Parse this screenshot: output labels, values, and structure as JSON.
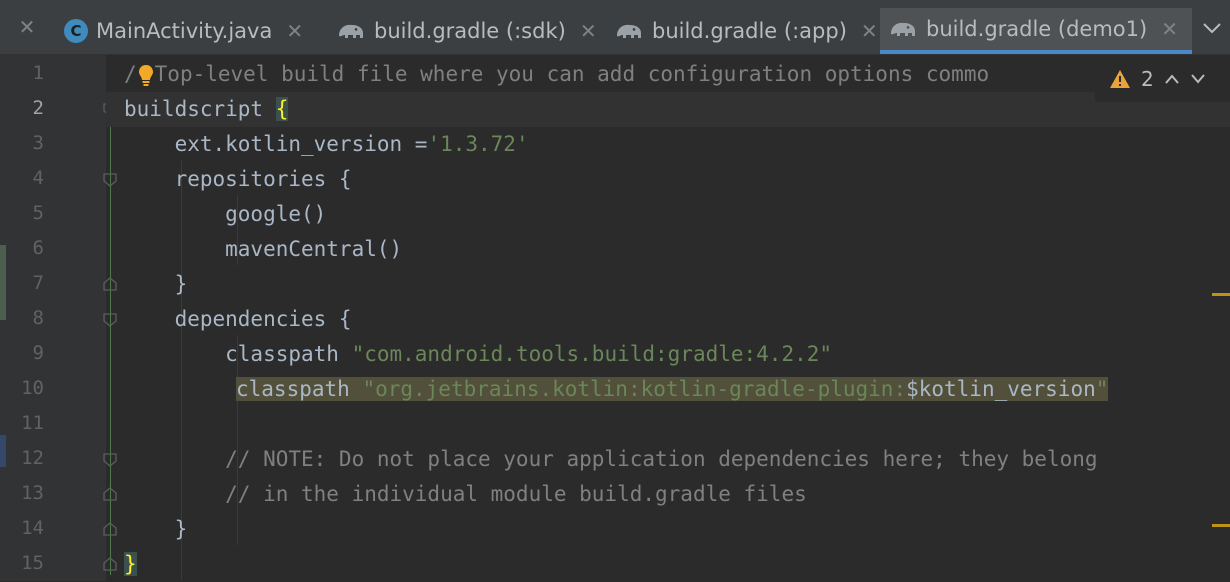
{
  "tabs": [
    {
      "label": "MainActivity.java",
      "icon": "java-class-icon",
      "active": false
    },
    {
      "label": "build.gradle (:sdk)",
      "icon": "gradle-icon",
      "active": false
    },
    {
      "label": "build.gradle (:app)",
      "icon": "gradle-icon",
      "active": false
    },
    {
      "label": "build.gradle (demo1)",
      "icon": "gradle-icon",
      "active": true
    }
  ],
  "inspections": {
    "warning_count": "2"
  },
  "line_numbers": [
    "1",
    "2",
    "3",
    "4",
    "5",
    "6",
    "7",
    "8",
    "9",
    "10",
    "11",
    "12",
    "13",
    "14",
    "15"
  ],
  "code": {
    "l1_slash": "/",
    "l1_comment": "Top-level build file where you can add configuration options commo",
    "l2_ident": "buildscript ",
    "l2_brace": "{",
    "l3_ident": "    ext.kotlin_version =",
    "l3_str": "'1.3.72'",
    "l4": "    repositories {",
    "l5": "        google()",
    "l6": "        mavenCentral()",
    "l7": "    }",
    "l8": "    dependencies {",
    "l9_ident": "        classpath ",
    "l9_str": "\"com.android.tools.build:gradle:4.2.2\"",
    "l10_ident": "classpath ",
    "l10_str": "\"org.jetbrains.kotlin:kotlin-gradle-plugin:",
    "l10_var": "$kotlin_version",
    "l10_end": "\"",
    "l12": "        // NOTE: Do not place your application dependencies here; they belong",
    "l13": "        // in the individual module build.gradle files",
    "l14": "    }",
    "l15": "}"
  },
  "colors": {
    "background": "#2b2b2b",
    "string": "#6a8759",
    "comment": "#808080",
    "identifier": "#a9b7c6",
    "brace_match": "#ffef28",
    "tab_active_underline": "#4a88c7",
    "warning": "#be9117"
  }
}
